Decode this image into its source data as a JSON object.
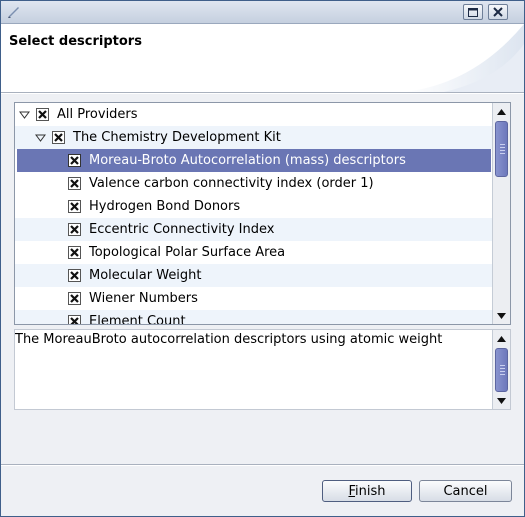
{
  "window": {
    "title": "",
    "buttons": [
      "maximize",
      "close"
    ]
  },
  "header": {
    "title": "Select descriptors"
  },
  "tree": {
    "rows": [
      {
        "label": "All Providers",
        "level": 0,
        "checked": true,
        "expanded": true
      },
      {
        "label": "The Chemistry Development Kit",
        "level": 1,
        "checked": true,
        "expanded": true
      },
      {
        "label": "Moreau-Broto Autocorrelation (mass) descriptors",
        "level": 2,
        "checked": true,
        "selected": true
      },
      {
        "label": "Valence carbon connectivity index (order 1)",
        "level": 2,
        "checked": true
      },
      {
        "label": "Hydrogen Bond Donors",
        "level": 2,
        "checked": true
      },
      {
        "label": "Eccentric Connectivity Index",
        "level": 2,
        "checked": true
      },
      {
        "label": "Topological Polar Surface Area",
        "level": 2,
        "checked": true
      },
      {
        "label": "Molecular Weight",
        "level": 2,
        "checked": true
      },
      {
        "label": "Wiener Numbers",
        "level": 2,
        "checked": true
      },
      {
        "label": "Element Count",
        "level": 2,
        "checked": true
      }
    ]
  },
  "description": {
    "text": "The MoreauBroto autocorrelation descriptors using atomic weight"
  },
  "buttons": {
    "finish": "Finish",
    "cancel": "Cancel"
  },
  "colors": {
    "selection": "#6a76b4",
    "alt_row": "#eef4fb",
    "scroll_thumb": "#7580c2"
  }
}
